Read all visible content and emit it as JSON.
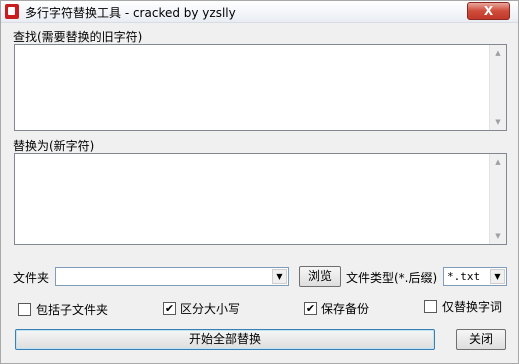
{
  "window": {
    "title": "多行字符替换工具 - cracked by yzslly",
    "close_label": "X"
  },
  "find": {
    "label": "查找(需要替换的旧字符)",
    "value": ""
  },
  "replace": {
    "label": "替换为(新字符)",
    "value": ""
  },
  "folder": {
    "label": "文件夹",
    "value": "",
    "browse_label": "浏览"
  },
  "file_type": {
    "label": "文件类型(*.后缀)",
    "value": "*.txt"
  },
  "options": {
    "include_subfolders": {
      "label": "包括子文件夹",
      "checked": false
    },
    "case_sensitive": {
      "label": "区分大小写",
      "checked": true
    },
    "keep_backup": {
      "label": "保存备份",
      "checked": true
    },
    "whole_word": {
      "label": "仅替换字词",
      "checked": false
    }
  },
  "actions": {
    "replace_all_label": "开始全部替换",
    "close_label": "关闭"
  },
  "icons": {
    "check_mark": "✔"
  }
}
